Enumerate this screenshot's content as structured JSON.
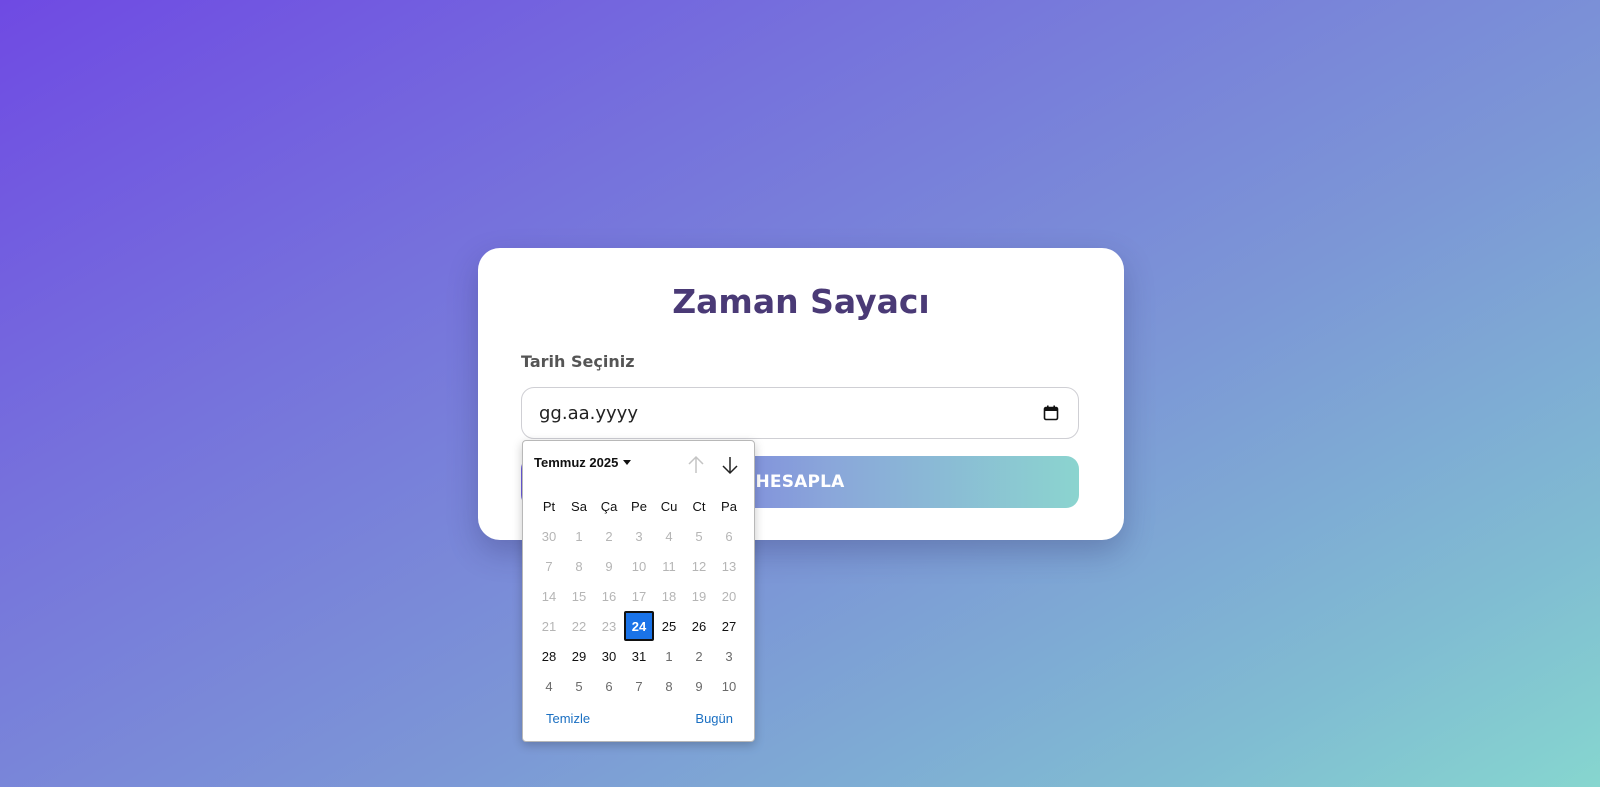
{
  "card": {
    "title": "Zaman Sayacı",
    "field_label": "Tarih Seçiniz",
    "date_input": {
      "value": "gg.aa.yyyy",
      "icon": "calendar-icon"
    },
    "submit_label": "HESAPLA"
  },
  "picker": {
    "month_label": "Temmuz 2025",
    "prev_icon": "arrow-up-icon",
    "next_icon": "arrow-down-icon",
    "weekdays": [
      "Pt",
      "Sa",
      "Ça",
      "Pe",
      "Cu",
      "Ct",
      "Pa"
    ],
    "weeks": [
      [
        "30",
        "1",
        "2",
        "3",
        "4",
        "5",
        "6"
      ],
      [
        "7",
        "8",
        "9",
        "10",
        "11",
        "12",
        "13"
      ],
      [
        "14",
        "15",
        "16",
        "17",
        "18",
        "19",
        "20"
      ],
      [
        "21",
        "22",
        "23",
        "24",
        "25",
        "26",
        "27"
      ],
      [
        "28",
        "29",
        "30",
        "31",
        "1",
        "2",
        "3"
      ],
      [
        "4",
        "5",
        "6",
        "7",
        "8",
        "9",
        "10"
      ]
    ],
    "selected_day": "24",
    "clear_label": "Temizle",
    "today_label": "Bugün"
  },
  "colors": {
    "accent": "#1a73e8",
    "title": "#4a3a76",
    "link": "#1a6fc2"
  }
}
